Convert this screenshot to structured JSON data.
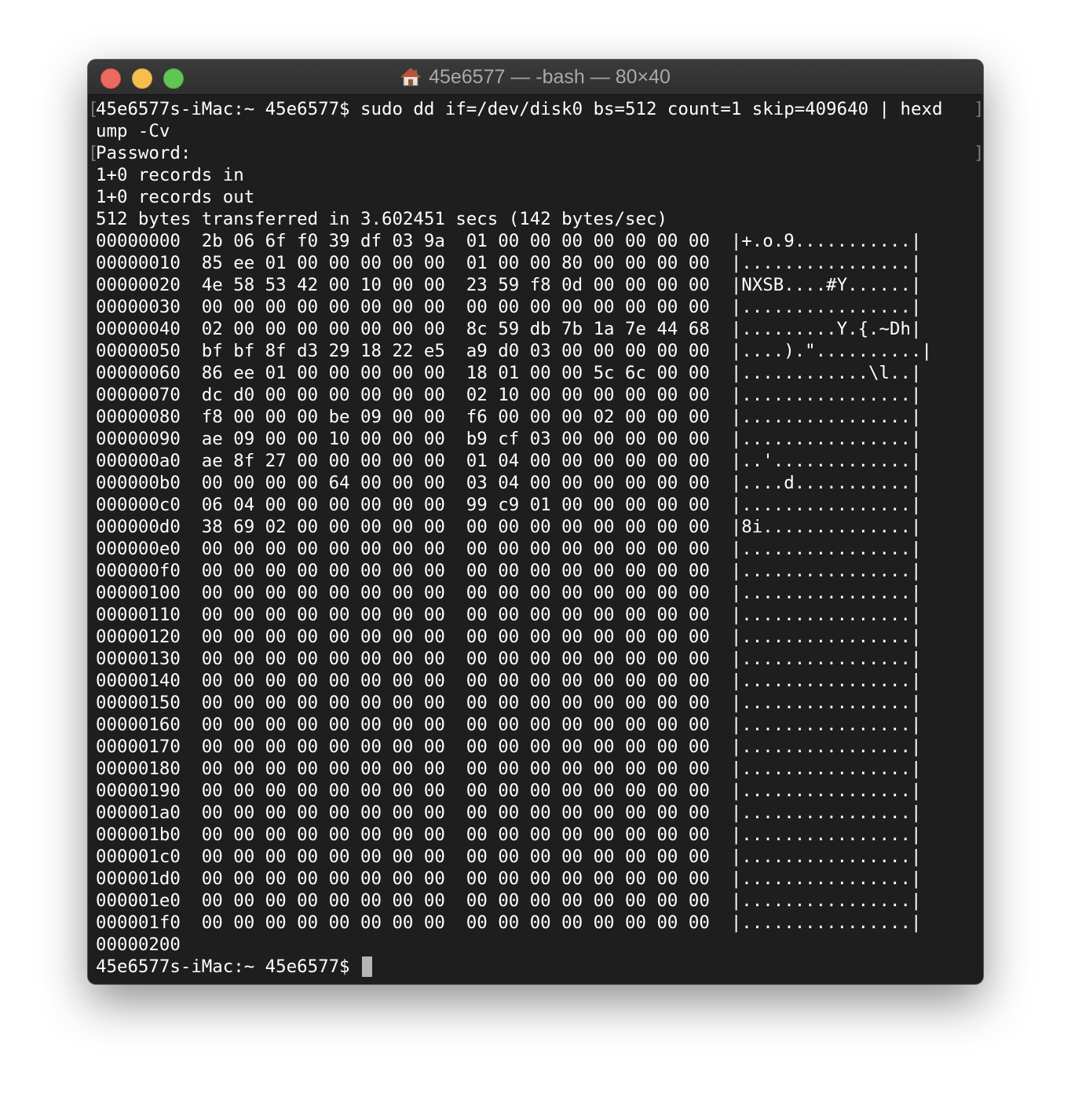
{
  "window": {
    "title": "45e6577 — -bash — 80×40",
    "colors": {
      "background": "#1e1e1e",
      "text": "#ffffff",
      "close": "#ed6a5e",
      "minimize": "#f4bf4f",
      "maximize": "#61c554"
    }
  },
  "terminal": {
    "command_line": "45e6577s-iMac:~ 45e6577$ sudo dd if=/dev/disk0 bs=512 count=1 skip=409640 | hexd",
    "command_wrap": "ump -Cv",
    "password_prompt": "Password:",
    "output": [
      "1+0 records in",
      "1+0 records out",
      "512 bytes transferred in 3.602451 secs (142 bytes/sec)"
    ],
    "hexdump": [
      "00000000  2b 06 6f f0 39 df 03 9a  01 00 00 00 00 00 00 00  |+.o.9...........|",
      "00000010  85 ee 01 00 00 00 00 00  01 00 00 80 00 00 00 00  |................|",
      "00000020  4e 58 53 42 00 10 00 00  23 59 f8 0d 00 00 00 00  |NXSB....#Y......|",
      "00000030  00 00 00 00 00 00 00 00  00 00 00 00 00 00 00 00  |................|",
      "00000040  02 00 00 00 00 00 00 00  8c 59 db 7b 1a 7e 44 68  |.........Y.{.~Dh|",
      "00000050  bf bf 8f d3 29 18 22 e5  a9 d0 03 00 00 00 00 00  |....).\"..........|",
      "00000060  86 ee 01 00 00 00 00 00  18 01 00 00 5c 6c 00 00  |............\\l..|",
      "00000070  dc d0 00 00 00 00 00 00  02 10 00 00 00 00 00 00  |................|",
      "00000080  f8 00 00 00 be 09 00 00  f6 00 00 00 02 00 00 00  |................|",
      "00000090  ae 09 00 00 10 00 00 00  b9 cf 03 00 00 00 00 00  |................|",
      "000000a0  ae 8f 27 00 00 00 00 00  01 04 00 00 00 00 00 00  |..'.............|",
      "000000b0  00 00 00 00 64 00 00 00  03 04 00 00 00 00 00 00  |....d...........|",
      "000000c0  06 04 00 00 00 00 00 00  99 c9 01 00 00 00 00 00  |................|",
      "000000d0  38 69 02 00 00 00 00 00  00 00 00 00 00 00 00 00  |8i..............|",
      "000000e0  00 00 00 00 00 00 00 00  00 00 00 00 00 00 00 00  |................|",
      "000000f0  00 00 00 00 00 00 00 00  00 00 00 00 00 00 00 00  |................|",
      "00000100  00 00 00 00 00 00 00 00  00 00 00 00 00 00 00 00  |................|",
      "00000110  00 00 00 00 00 00 00 00  00 00 00 00 00 00 00 00  |................|",
      "00000120  00 00 00 00 00 00 00 00  00 00 00 00 00 00 00 00  |................|",
      "00000130  00 00 00 00 00 00 00 00  00 00 00 00 00 00 00 00  |................|",
      "00000140  00 00 00 00 00 00 00 00  00 00 00 00 00 00 00 00  |................|",
      "00000150  00 00 00 00 00 00 00 00  00 00 00 00 00 00 00 00  |................|",
      "00000160  00 00 00 00 00 00 00 00  00 00 00 00 00 00 00 00  |................|",
      "00000170  00 00 00 00 00 00 00 00  00 00 00 00 00 00 00 00  |................|",
      "00000180  00 00 00 00 00 00 00 00  00 00 00 00 00 00 00 00  |................|",
      "00000190  00 00 00 00 00 00 00 00  00 00 00 00 00 00 00 00  |................|",
      "000001a0  00 00 00 00 00 00 00 00  00 00 00 00 00 00 00 00  |................|",
      "000001b0  00 00 00 00 00 00 00 00  00 00 00 00 00 00 00 00  |................|",
      "000001c0  00 00 00 00 00 00 00 00  00 00 00 00 00 00 00 00  |................|",
      "000001d0  00 00 00 00 00 00 00 00  00 00 00 00 00 00 00 00  |................|",
      "000001e0  00 00 00 00 00 00 00 00  00 00 00 00 00 00 00 00  |................|",
      "000001f0  00 00 00 00 00 00 00 00  00 00 00 00 00 00 00 00  |................|",
      "00000200"
    ],
    "prompt": "45e6577s-iMac:~ 45e6577$ "
  }
}
